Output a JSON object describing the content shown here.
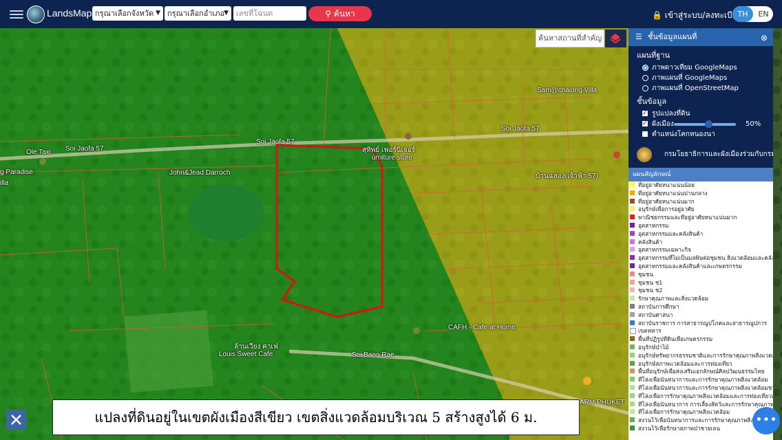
{
  "topbar": {
    "logo_text": "LandsMaps",
    "province_placeholder": "กรุณาเลือกจังหวัด",
    "district_placeholder": "กรุณาเลือกอำเภอ",
    "deed_placeholder": "เลขที่โฉนด",
    "search_label": "ค้นหา",
    "login_label": "เข้าสู่ระบบ/ลงทะเบียน",
    "lang_th": "TH",
    "lang_en": "EN"
  },
  "map": {
    "place_search_placeholder": "ค้นหาสถานที่สำคัญ",
    "labels": {
      "ole_taxi": "Ole Taxi",
      "paradise": "g Paradise",
      "villa": "illa",
      "john_jead": "John&Jead Darroch",
      "soi_jaofa_1": "Soi Jaofa 57",
      "soi_jaofa_2": "Soi Jaofa 57",
      "soi_jaofa_3": "Soi Jaofa 57",
      "furniture": "สุทิพย์ เฟอร์นิเจอร์",
      "furniture_en": "urniture store",
      "sam_chalong": "Sam@chalong Villa",
      "ban_chalong": "บ้านฉลอง(เจ้าฟ้า 57)",
      "cafh": "CAFH - Cafe at Home",
      "louis_th": "ล้านเวียง คาเฟ่",
      "louis_en": "Louis Sweet Cafe",
      "soi_bang_rae": "Soi Bang Rae",
      "arm_phuket": "ARM PHUKET"
    }
  },
  "panel": {
    "title": "ชั้นข้อมูลแผนที่",
    "basemap_title": "แผนที่ฐาน",
    "basemaps": [
      {
        "label": "ภาพดาวเทียม GoogleMaps",
        "selected": true
      },
      {
        "label": "ภาพแผนที่ GoogleMaps",
        "selected": false
      },
      {
        "label": "ภาพแผนที่ OpenStreetMap",
        "selected": false
      }
    ],
    "layers_title": "ชั้นข้อมูล",
    "layers": [
      {
        "label": "รูปแปลงที่ดิน",
        "checked": true
      },
      {
        "label": "ผังเมือง",
        "checked": true,
        "opacity": "50%"
      },
      {
        "label": "ตำแหน่งโคกหนองนา",
        "checked": false
      }
    ],
    "agency": "กรมโยธาธิการและผังเมืองร่วมกับกรมที่ดิน",
    "legend_title": "แผนสัญลักษณ์",
    "legend": [
      {
        "label": "ที่อยู่อาศัยหนาแน่นน้อย",
        "color": "#ffff33"
      },
      {
        "label": "ที่อยู่อาศัยหนาแน่นปานกลาง",
        "color": "#f7a800"
      },
      {
        "label": "ที่อยู่อาศัยหนาแน่นมาก",
        "color": "#8b5a1a"
      },
      {
        "label": "อนุรักษ์เพื่อการอยู่อาศัย",
        "color": "#ffe97a"
      },
      {
        "label": "พาณิชยกรรมและที่อยู่อาศัยหนาแน่นมาก",
        "color": "#e02020"
      },
      {
        "label": "อุตสาหกรรม",
        "color": "#7b1fa2"
      },
      {
        "label": "อุตสาหกรรมและคลังสินค้า",
        "color": "#b040c0"
      },
      {
        "label": "คลังสินค้า",
        "color": "#d070e0"
      },
      {
        "label": "อุตสาหกรรมเฉพาะกิจ",
        "color": "#e39ee8"
      },
      {
        "label": "อุตสาหกรรมที่ไม่เป็นมลพิษต่อชุมชน สิ่งแวดล้อมและคลังสินค้า",
        "color": "#9c27b0"
      },
      {
        "label": "อุตสาหกรรมและคลังสินค้าและเกษตรกรรม",
        "color": "#6a2f8e"
      },
      {
        "label": "ชุมชน",
        "color": "#e88a8a"
      },
      {
        "label": "ชุมชน ช1",
        "color": "#f0a0a0"
      },
      {
        "label": "ชุมชน ช2",
        "color": "#f5b5b5"
      },
      {
        "label": "รักษาคุณภาพและสิ่งแวดล้อม",
        "color": "#b9f2a4"
      },
      {
        "label": "สถาบันการศึกษา",
        "color": "#808080"
      },
      {
        "label": "สถาบันศาสนา",
        "color": "#a0a0a0"
      },
      {
        "label": "สถาบันราชการ การสาธารณูปโภคและสาธารณูปการ",
        "color": "#2a7fd4"
      },
      {
        "label": "เขตทหาร",
        "color": "#ffffff"
      },
      {
        "label": "พื้นที่ปฏิรูปที่ดินเพื่อเกษตรกรรม",
        "color": "#8b6a1a"
      },
      {
        "label": "อนุรักษ์ป่าไม้",
        "color": "#6fb35a"
      },
      {
        "label": "อนุรักษ์ทรัพยากรธรรมชาติและการรักษาคุณภาพสิ่งแวดล้อม",
        "color": "#9fcf7a"
      },
      {
        "label": "อนุรักษ์สภาพแวดล้อมและการท่องเที่ยว",
        "color": "#5aa640"
      },
      {
        "label": "พื้นที่อนุรักษ์เพื่อส่งเสริมเอกลักษณ์ศิลปวัฒนธรรมไทย",
        "color": "#c89b5a"
      },
      {
        "label": "ที่โล่งเพื่อนันทนาการและการรักษาคุณภาพสิ่งแวดล้อม",
        "color": "#7ad070"
      },
      {
        "label": "ที่โล่งเพื่อนันทนาการและการรักษาคุณภาพสิ่งแวดล้อมชายฝั่ง",
        "color": "#b0e0a0"
      },
      {
        "label": "ที่โล่งเพื่อการรักษาคุณภาพสิ่งแวดล้อมและการท่องเที่ยวและการ",
        "color": "#98d48a"
      },
      {
        "label": "ที่โล่งเพื่อนันทนาการ การเลี้ยงสัตว์และการรักษาคุณภาพ",
        "color": "#a8e078"
      },
      {
        "label": "ที่โล่งเพื่อการรักษาคุณภาพสิ่งแวดล้อม",
        "color": "#c0e8a0"
      },
      {
        "label": "สงวนไว้เพื่อนันทนาการและการรักษาคุณภาพสิ่งแวดล้อม",
        "color": "#60b050"
      },
      {
        "label": "สงวนไว้เพื่อรักษาสภาพป่าชายเลน",
        "color": "#3f8f40"
      }
    ]
  },
  "caption": "แปลงที่ดินอยู่ในเขตผังเมืองสีเขียว เขตสิ่งแวดล้อมบริเวณ 5 สร้างสูงได้ 6 ม."
}
